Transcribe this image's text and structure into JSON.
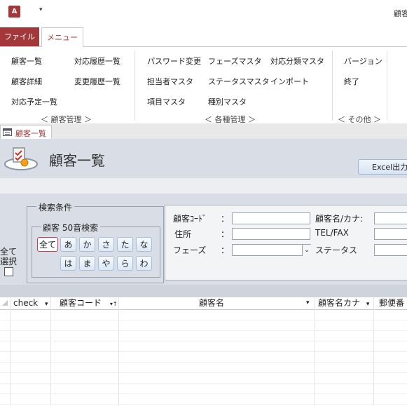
{
  "app": {
    "icon_letter": "A",
    "qat_arrow": "▾",
    "window_title": "顧客"
  },
  "ribbon": {
    "tabs": {
      "file": "ファイル",
      "menu": "メニュー"
    },
    "customer": {
      "list": "顧客一覧",
      "detail": "顧客詳細",
      "schedule": "対応予定一覧",
      "history": "対応履歴一覧",
      "change_history": "変更履歴一覧",
      "group": "＜ 顧客管理 ＞"
    },
    "master": {
      "password": "パスワード変更",
      "phase_master": "フェーズマスタ",
      "category_master": "対応分類マスタ",
      "staff_master": "担当者マスタ",
      "status_master": "ステータスマスタ",
      "import": "インポート",
      "item_master": "項目マスタ",
      "type_master": "種別マスタ",
      "group": "＜ 各種管理 ＞"
    },
    "other": {
      "version": "バージョン",
      "exit": "終了",
      "group": "＜ その他 ＞"
    }
  },
  "doc_tab": {
    "label": "顧客一覧"
  },
  "form": {
    "title": "顧客一覧",
    "excel_button": "Excel出力",
    "select_all": "全て\n選択",
    "search_legend": "検索条件",
    "kana_legend": "顧客 50音検索",
    "kana_row1": [
      "全て",
      "あ",
      "か",
      "さ",
      "た",
      "な"
    ],
    "kana_row2": [
      "は",
      "ま",
      "や",
      "ら",
      "わ"
    ],
    "fields": {
      "code_label": "顧客ｺｰﾄﾞ",
      "address_label": "住所",
      "phase_label": "フェーズ",
      "colon": "：",
      "name_label": "顧客名/カナ:",
      "tel_label": "TEL/FAX",
      "status_label": "ステータス"
    },
    "dropdown_arrow": "⌄"
  },
  "grid": {
    "columns": [
      "check",
      "顧客コード",
      "顧客名",
      "顧客名カナ",
      "郵便番"
    ],
    "sort_arrow": "▾",
    "filter_arrow": "▾↑"
  }
}
